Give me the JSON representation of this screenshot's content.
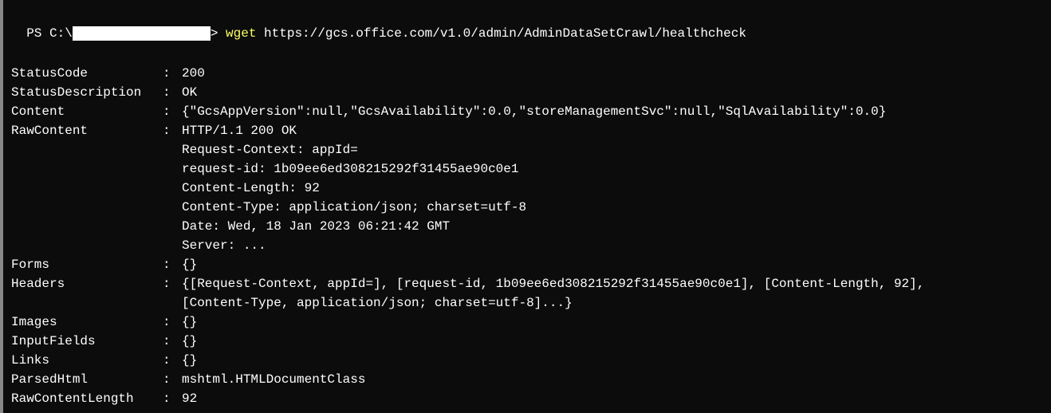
{
  "prompt": {
    "prefix": "PS C:\\",
    "end": "> ",
    "command": "wget",
    "url": "https://gcs.office.com/v1.0/admin/AdminDataSetCrawl/healthcheck"
  },
  "output": {
    "StatusCode": "200",
    "StatusDescription": "OK",
    "Content": "{\"GcsAppVersion\":null,\"GcsAvailability\":0.0,\"storeManagementSvc\":null,\"SqlAvailability\":0.0}",
    "RawContent_lines": [
      "HTTP/1.1 200 OK",
      "Request-Context: appId=",
      "request-id: 1b09ee6ed308215292f31455ae90c0e1",
      "Content-Length: 92",
      "Content-Type: application/json; charset=utf-8",
      "Date: Wed, 18 Jan 2023 06:21:42 GMT",
      "Server: ..."
    ],
    "Forms": "{}",
    "Headers_lines": [
      "{[Request-Context, appId=], [request-id, 1b09ee6ed308215292f31455ae90c0e1], [Content-Length, 92],",
      "[Content-Type, application/json; charset=utf-8]...}"
    ],
    "Images": "{}",
    "InputFields": "{}",
    "Links": "{}",
    "ParsedHtml": "mshtml.HTMLDocumentClass",
    "RawContentLength": "92"
  },
  "labels": {
    "StatusCode": "StatusCode",
    "StatusDescription": "StatusDescription",
    "Content": "Content",
    "RawContent": "RawContent",
    "Forms": "Forms",
    "Headers": "Headers",
    "Images": "Images",
    "InputFields": "InputFields",
    "Links": "Links",
    "ParsedHtml": "ParsedHtml",
    "RawContentLength": "RawContentLength"
  },
  "colon": ": "
}
